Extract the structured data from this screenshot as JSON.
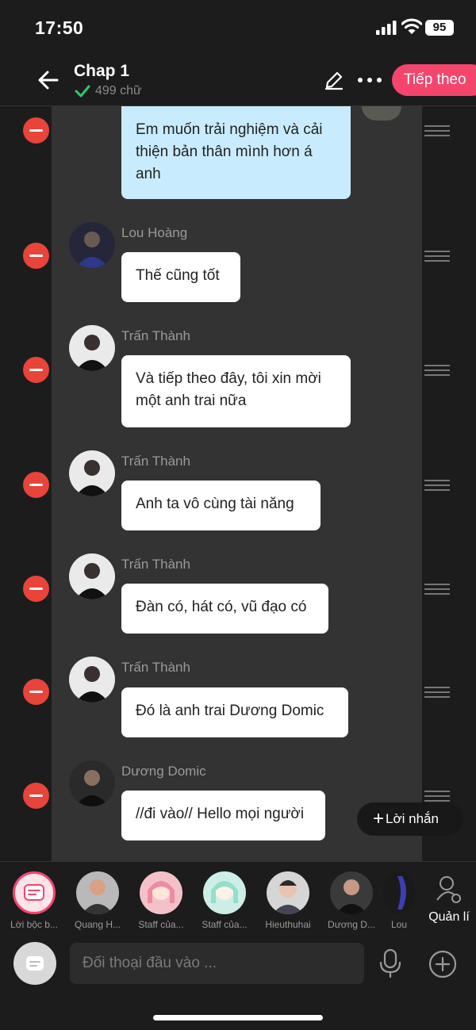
{
  "status": {
    "time": "17:50",
    "battery": "95"
  },
  "header": {
    "title": "Chap 1",
    "word_count": "499 chữ",
    "next_label": "Tiếp theo"
  },
  "messages": [
    {
      "sender": "",
      "text": "Em muốn trải nghiệm và cải thiện bản thân mình hơn á anh",
      "style": "blue"
    },
    {
      "sender": "Lou Hoàng",
      "text": "Thế cũng tốt",
      "style": "white"
    },
    {
      "sender": "Trấn Thành",
      "text": "Và tiếp theo đây, tôi xin mời một anh trai nữa",
      "style": "white"
    },
    {
      "sender": "Trấn Thành",
      "text": "Anh ta vô cùng tài năng",
      "style": "white"
    },
    {
      "sender": "Trấn Thành",
      "text": "Đàn có, hát có, vũ đạo có",
      "style": "white"
    },
    {
      "sender": "Trấn Thành",
      "text": "Đó là anh trai Dương Domic",
      "style": "white"
    },
    {
      "sender": "Dương Domic",
      "text": "//đi vào// Hello mọi người",
      "style": "white"
    }
  ],
  "add_message_label": "Lời nhắn",
  "characters": [
    {
      "label": "Lời bộc b..."
    },
    {
      "label": "Quang H..."
    },
    {
      "label": "Staff của..."
    },
    {
      "label": "Staff của..."
    },
    {
      "label": "Hieuthuhai"
    },
    {
      "label": "Dương D..."
    },
    {
      "label": "Lou"
    }
  ],
  "manage_label": "Quản lí",
  "input": {
    "placeholder": "Đối thoại đầu vào ..."
  },
  "colors": {
    "accent": "#f4466d",
    "bubble_blue": "#c8ecfd",
    "remove_red": "#e8443a"
  }
}
